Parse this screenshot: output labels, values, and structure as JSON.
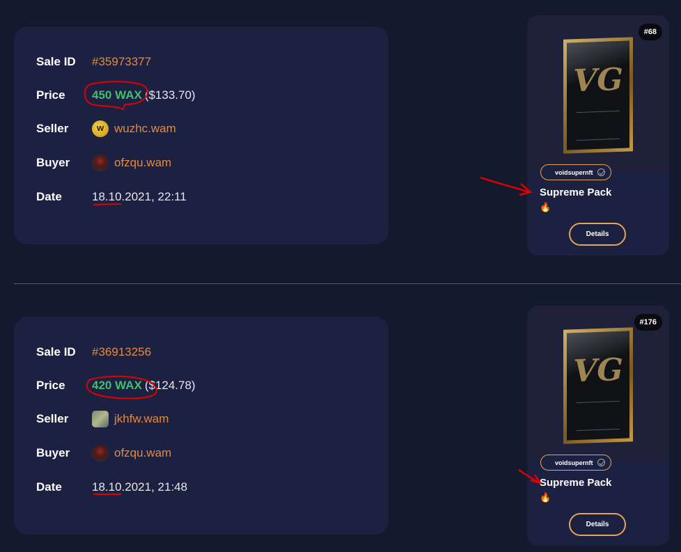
{
  "sales": [
    {
      "sale_id_label": "Sale ID",
      "sale_id": "#35973377",
      "price_label": "Price",
      "price_wax": "450 WAX",
      "price_usd": "($133.70)",
      "seller_label": "Seller",
      "seller": "wuzhc.wam",
      "buyer_label": "Buyer",
      "buyer": "ofzqu.wam",
      "date_label": "Date",
      "date": "18.10.2021, 22:11"
    },
    {
      "sale_id_label": "Sale ID",
      "sale_id": "#36913256",
      "price_label": "Price",
      "price_wax": "420 WAX",
      "price_usd": "($124.78)",
      "seller_label": "Seller",
      "seller": "jkhfw.wam",
      "buyer_label": "Buyer",
      "buyer": "ofzqu.wam",
      "date_label": "Date",
      "date": "18.10.2021, 21:48"
    }
  ],
  "nfts": [
    {
      "mint": "#68",
      "collection": "voidsupernft",
      "name": "Supreme Pack",
      "emoji": "🔥",
      "details_label": "Details",
      "pack_logo": "VG"
    },
    {
      "mint": "#176",
      "collection": "voidsupernft",
      "name": "Supreme Pack",
      "emoji": "🔥",
      "details_label": "Details",
      "pack_logo": "VG"
    }
  ],
  "colors": {
    "background": "#141a2e",
    "card": "#1c2142",
    "accent_orange": "#e58a3c",
    "price_green": "#3fbf6f",
    "annotation_red": "#e00000"
  }
}
